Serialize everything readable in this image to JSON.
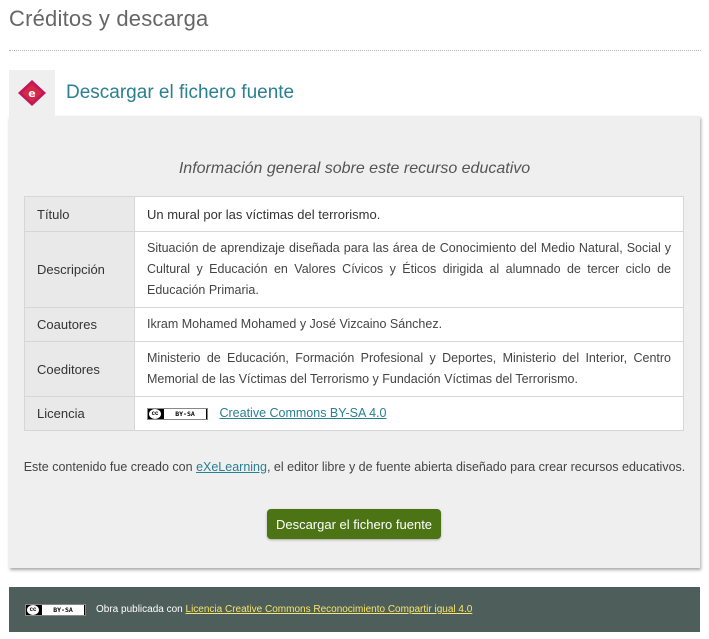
{
  "page": {
    "title": "Créditos y descarga"
  },
  "idevice": {
    "title": "Descargar el fichero fuente"
  },
  "info": {
    "heading": "Información general sobre este recurso educativo",
    "rows": [
      {
        "label": "Título",
        "value": "Un mural por las víctimas del terrorismo."
      },
      {
        "label": "Descripción",
        "value": "Situación de aprendizaje diseñada para las área de Conocimiento del Medio Natural, Social y Cultural y Educación en Valores Cívicos y Éticos dirigida al alumnado de tercer ciclo de Educación Primaria."
      },
      {
        "label": "Coautores",
        "value": "Ikram Mohamed Mohamed y José Vizcaino Sánchez."
      },
      {
        "label": "Coeditores",
        "value": "Ministerio de Educación, Formación Profesional y Deportes, Ministerio del Interior, Centro Memorial de las Víctimas del Terrorismo y Fundación Víctimas del Terrorismo."
      },
      {
        "label": "Licencia",
        "badge": "BY-SA",
        "link_text": "Creative Commons BY-SA 4.0"
      }
    ]
  },
  "credit": {
    "before": "Este contenido fue creado con ",
    "link_text": "eXeLearning",
    "after": ", el editor libre y de fuente abierta diseñado para crear recursos educativos."
  },
  "download_button": {
    "label": "Descargar el fichero fuente"
  },
  "footer": {
    "badge": "BY-SA",
    "text": "Obra publicada con ",
    "link_text": "Licencia Creative Commons Reconocimiento Compartir igual 4.0"
  },
  "colors": {
    "accent": "#2a7f91",
    "button": "#4c7415",
    "footer_bg": "#4e5e5b",
    "footer_link": "#f5e56a",
    "logo": "#c2185b"
  },
  "icons": {
    "idevice_icon": "exe-logo-icon",
    "license_icon": "cc-by-sa-icon"
  }
}
